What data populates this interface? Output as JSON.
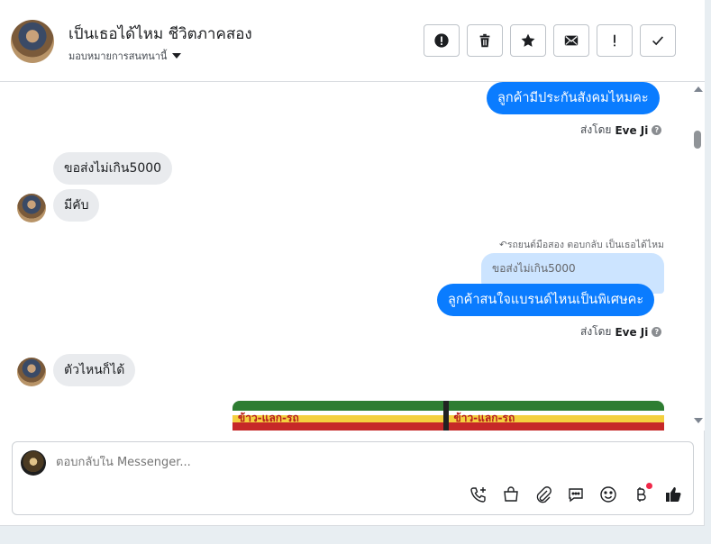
{
  "header": {
    "title": "เป็นเธอได้ไหม ชีวิตภาคสอง",
    "subtitle": "มอบหมายการสนทนานี้",
    "actions": [
      {
        "name": "report",
        "icon": "alert-circle-icon"
      },
      {
        "name": "delete",
        "icon": "trash-icon"
      },
      {
        "name": "star",
        "icon": "star-icon"
      },
      {
        "name": "mark-unread",
        "icon": "envelope-icon"
      },
      {
        "name": "spam",
        "icon": "exclamation-icon"
      },
      {
        "name": "done",
        "icon": "checkmark-icon"
      }
    ]
  },
  "messages": {
    "m1_text": "ลูกค้ามีประกันสังคมไหมคะ",
    "m1_sent_label": "ส่งโดย",
    "m1_sender": "Eve Ji",
    "m2_text": "ขอส่งไม่เกิน5000",
    "m3_text": "มีคับ",
    "reply_note": "รถยนต์มือสอง ตอบกลับ เป็นเธอได้ไหม",
    "quoted_text": "ขอส่งไม่เกิน5000",
    "m4_text": "ลูกค้าสนใจแบรนด์ไหนเป็นพิเศษคะ",
    "m4_sent_label": "ส่งโดย",
    "m4_sender": "Eve Ji",
    "m5_text": "ตัวไหนก็ได้",
    "attachment_label_1": "ข้าว-แลก-รถ",
    "attachment_label_2": "ข้าว-แลก-รถ"
  },
  "composer": {
    "placeholder": "ตอบกลับใน Messenger...",
    "tools": [
      "phone-plus-icon",
      "shopping-bag-icon",
      "paperclip-icon",
      "speech-bubble-icon",
      "smiley-icon",
      "baht-icon",
      "thumbs-up-icon"
    ],
    "accent": "#f02849"
  },
  "colors": {
    "outgoing_bubble": "#0a7cff",
    "incoming_bubble": "#e9ebee",
    "quoted_bubble": "#cce4ff"
  }
}
